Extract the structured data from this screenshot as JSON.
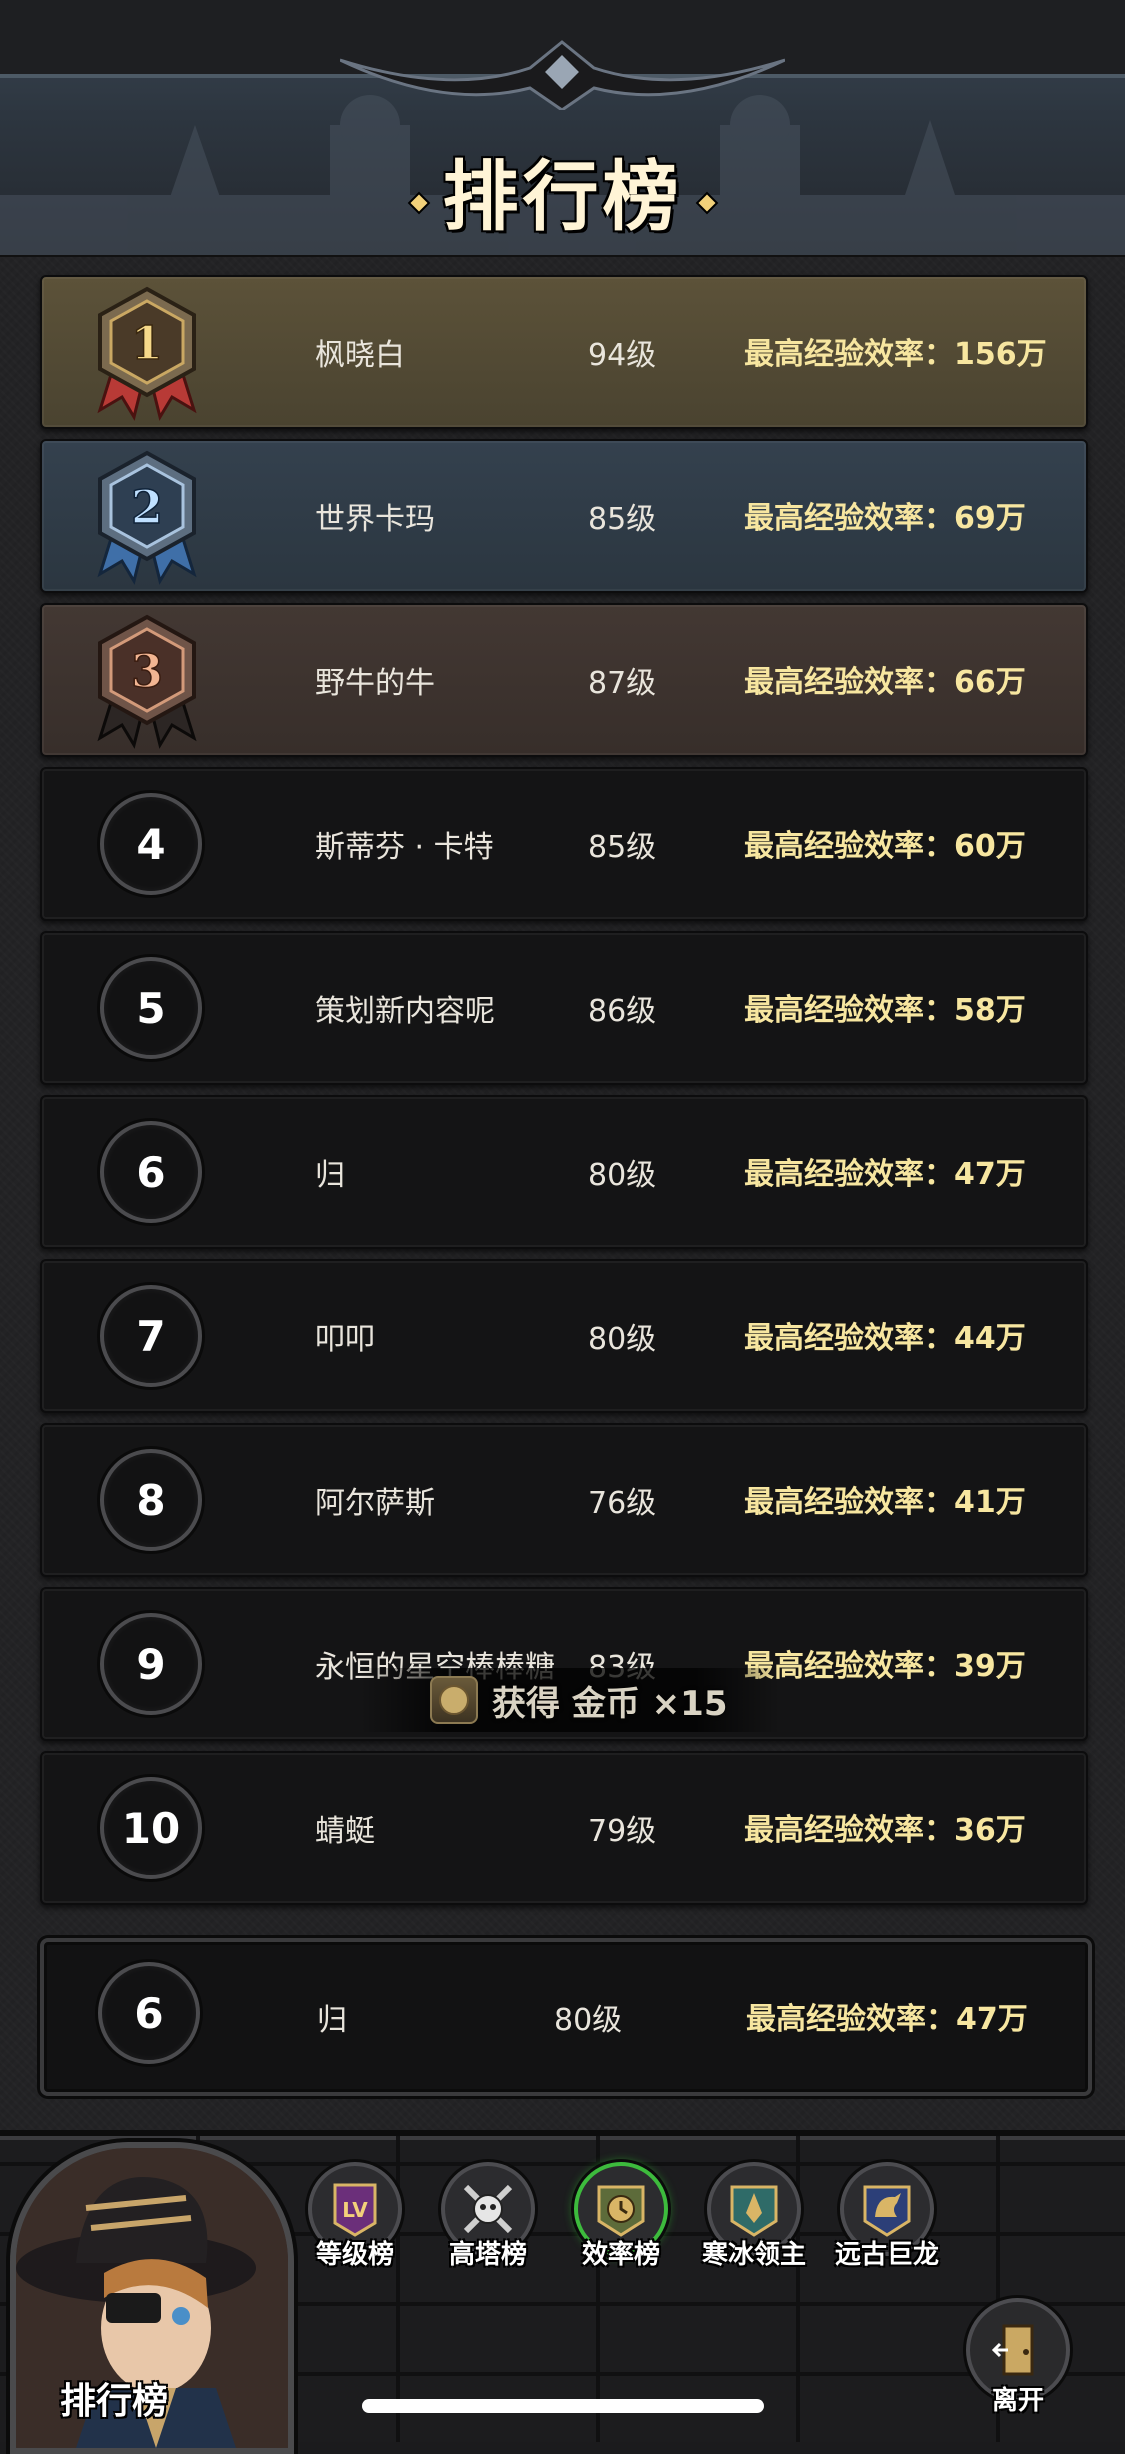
{
  "header": {
    "title": "排行榜"
  },
  "rankings": [
    {
      "rank": "1",
      "tier": "gold",
      "name": "枫晓白",
      "level": "94级",
      "efficiency": "最高经验效率：156万"
    },
    {
      "rank": "2",
      "tier": "silver",
      "name": "世界卡玛",
      "level": "85级",
      "efficiency": "最高经验效率：69万"
    },
    {
      "rank": "3",
      "tier": "bronze",
      "name": "野牛的牛",
      "level": "87级",
      "efficiency": "最高经验效率：66万"
    },
    {
      "rank": "4",
      "tier": "normal",
      "name": "斯蒂芬 · 卡特",
      "level": "85级",
      "efficiency": "最高经验效率：60万"
    },
    {
      "rank": "5",
      "tier": "normal",
      "name": "策划新内容呢",
      "level": "86级",
      "efficiency": "最高经验效率：58万"
    },
    {
      "rank": "6",
      "tier": "normal",
      "name": "归",
      "level": "80级",
      "efficiency": "最高经验效率：47万"
    },
    {
      "rank": "7",
      "tier": "normal",
      "name": "叩叩",
      "level": "80级",
      "efficiency": "最高经验效率：44万"
    },
    {
      "rank": "8",
      "tier": "normal",
      "name": "阿尔萨斯",
      "level": "76级",
      "efficiency": "最高经验效率：41万"
    },
    {
      "rank": "9",
      "tier": "normal",
      "name": "永恒的星空棒棒糖",
      "level": "83级",
      "efficiency": "最高经验效率：39万"
    },
    {
      "rank": "10",
      "tier": "normal",
      "name": "蜻蜓",
      "level": "79级",
      "efficiency": "最高经验效率：36万"
    }
  ],
  "my_rank": {
    "rank": "6",
    "name": "归",
    "level": "80级",
    "efficiency": "最高经验效率：47万"
  },
  "toast": {
    "icon": "gold-coin-icon",
    "text": "获得 金币 ×15"
  },
  "bottom_nav": {
    "portrait_label": "排行榜",
    "tabs": [
      {
        "label": "等级榜",
        "icon": "lv-badge-icon",
        "active": false
      },
      {
        "label": "高塔榜",
        "icon": "skull-swords-icon",
        "active": false
      },
      {
        "label": "效率榜",
        "icon": "clock-shield-icon",
        "active": true
      },
      {
        "label": "寒冰领主",
        "icon": "ice-crest-icon",
        "active": false
      },
      {
        "label": "远古巨龙",
        "icon": "dragon-icon",
        "active": false
      }
    ],
    "exit_label": "离开"
  },
  "colors": {
    "gold_row": "#5c5239",
    "silver_row": "#34414e",
    "bronze_row": "#433833",
    "efficiency_text": "#f7e6a0",
    "active_tab": "#3dbb3d"
  }
}
